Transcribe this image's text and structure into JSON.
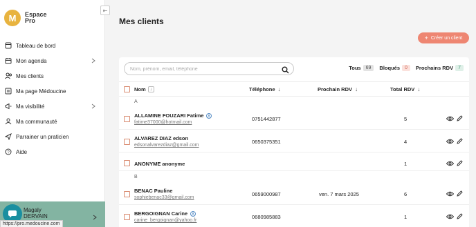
{
  "brand": {
    "logo_letter": "M",
    "line1": "Espace",
    "line2": "Pro"
  },
  "sidebar": {
    "collapse_glyph": "⇤",
    "items": [
      {
        "label": "Tableau de bord",
        "icon": "dashboard-icon"
      },
      {
        "label": "Mon agenda",
        "icon": "calendar-icon",
        "has_chevron": true
      },
      {
        "label": "Mes clients",
        "icon": "users-icon"
      },
      {
        "label": "Ma page Médoucine",
        "icon": "page-icon"
      },
      {
        "label": "Ma visibilité",
        "icon": "megaphone-icon",
        "has_chevron": true
      },
      {
        "label": "Ma communauté",
        "icon": "community-icon"
      },
      {
        "label": "Parrainer un praticien",
        "icon": "send-icon"
      },
      {
        "label": "Aide",
        "icon": "help-icon"
      }
    ],
    "user": {
      "first_name": "Magaly",
      "last_name": "DERVAIN"
    },
    "url_tooltip": "https://pro.medoucine.com"
  },
  "main": {
    "title": "Mes clients",
    "create_button": "Créer un client",
    "search": {
      "placeholder": "Nom, prénom, email, téléphone"
    },
    "filters": [
      {
        "label": "Tous",
        "count": "69",
        "tone": "gray"
      },
      {
        "label": "Bloqués",
        "count": "0",
        "tone": "red"
      },
      {
        "label": "Prochains RDV",
        "count": "7",
        "tone": "green"
      }
    ],
    "columns": {
      "name": "Nom",
      "phone": "Téléphone",
      "next_rdv": "Prochain RDV",
      "total_rdv": "Total RDV"
    },
    "groups": [
      {
        "letter": "A",
        "rows": [
          {
            "name": "ALLAMINE FOUZARI Fatime",
            "email": "fatime37000@hotmail.com",
            "phone": "0751442877",
            "next_rdv": "",
            "total": "5",
            "info": true
          },
          {
            "name": "ALVAREZ DIAZ edson",
            "email": "edsonalvarezdiaz@gmail.com",
            "phone": "0650375351",
            "next_rdv": "",
            "total": "4",
            "info": false
          },
          {
            "name": "ANONYME anonyme",
            "email": "",
            "phone": "",
            "next_rdv": "",
            "total": "1",
            "info": false
          }
        ]
      },
      {
        "letter": "B",
        "rows": [
          {
            "name": "BENAC Pauline",
            "email": "sophiebenac33@gmail.com",
            "phone": "0659000987",
            "next_rdv": "ven. 7 mars 2025",
            "total": "6",
            "info": false
          },
          {
            "name": "BERGOIGNAN Carine",
            "email": "carine_bergoignan@yahoo.fr",
            "phone": "0680985883",
            "next_rdv": "",
            "total": "1",
            "info": true
          }
        ]
      }
    ]
  },
  "colors": {
    "accent": "#ee8672",
    "logo": "#e8b33f",
    "user_bg": "#83b4a2",
    "avatar": "#1a8fa0"
  }
}
